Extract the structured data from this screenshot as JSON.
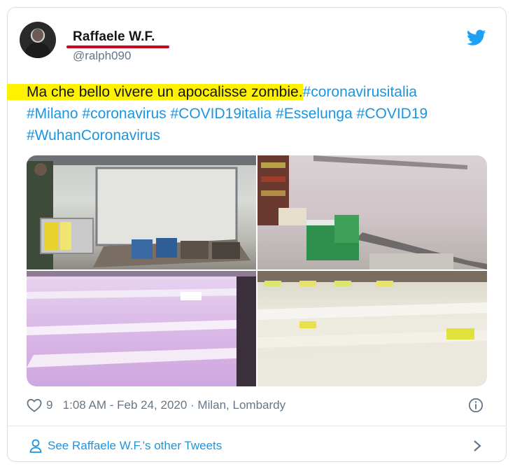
{
  "user": {
    "name": "Raffaele W.F.",
    "handle": "@ralph090"
  },
  "tweet": {
    "highlighted_text": "Ma che bello vivere un apocalisse zombie.",
    "hashtags": [
      "#coronavirusitalia",
      "#Milano",
      "#coronavirus",
      "#COVID19italia",
      "#Esselunga",
      "#COVID19",
      "#WuhanCoronavirus"
    ]
  },
  "footer": {
    "likes": "9",
    "timestamp": "1:08 AM - Feb 24, 2020",
    "location": "Milan, Lombardy",
    "see_more": "See Raffaele W.F.'s other Tweets"
  },
  "icons": {
    "logo": "twitter-bird-icon",
    "like": "heart-icon",
    "info": "info-icon",
    "profile": "person-icon",
    "chevron": "chevron-right-icon"
  },
  "colors": {
    "link": "#1b95e0",
    "highlight": "#fff200",
    "underline": "#d0021b",
    "muted": "#657786"
  }
}
